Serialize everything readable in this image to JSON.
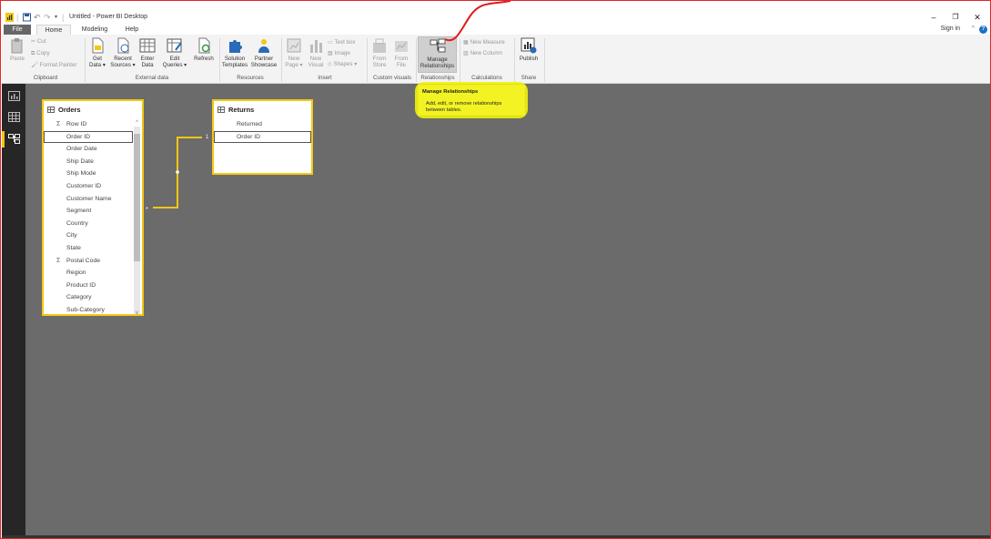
{
  "titlebar": {
    "app_title": "Untitled - Power BI Desktop",
    "minimize": "–",
    "restore": "❐",
    "close": "✕"
  },
  "tabs": {
    "file": "File",
    "home": "Home",
    "modeling": "Modeling",
    "help": "Help",
    "sign_in": "Sign in"
  },
  "ribbon": {
    "clipboard": {
      "paste": "Paste",
      "cut": "Cut",
      "copy": "Copy",
      "format_painter": "Format Painter",
      "group": "Clipboard"
    },
    "external_data": {
      "get_data": [
        "Get",
        "Data ▾"
      ],
      "recent_sources": [
        "Recent",
        "Sources ▾"
      ],
      "enter_data": [
        "Enter",
        "Data"
      ],
      "edit_queries": [
        "Edit",
        "Queries ▾"
      ],
      "refresh": "Refresh",
      "group": "External data"
    },
    "resources": {
      "solution_templates": [
        "Solution",
        "Templates"
      ],
      "partner_showcase": [
        "Partner",
        "Showcase"
      ],
      "group": "Resources"
    },
    "insert": {
      "new_page": [
        "New",
        "Page ▾"
      ],
      "new_visual": [
        "New",
        "Visual"
      ],
      "text_box": "Text box",
      "image": "Image",
      "shapes": "Shapes ▾",
      "group": "Insert"
    },
    "custom_visuals": {
      "from_store": [
        "From",
        "Store"
      ],
      "from_file": [
        "From",
        "File"
      ],
      "group": "Custom visuals"
    },
    "relationships": {
      "manage": [
        "Manage",
        "Relationships"
      ],
      "group": "Relationships"
    },
    "calculations": {
      "new_measure": "New Measure",
      "new_column": "New Column",
      "group": "Calculations"
    },
    "share": {
      "publish": "Publish",
      "group": "Share"
    }
  },
  "tooltip": {
    "title": "Manage Relationships",
    "text": "Add, edit, or remove relationships between tables."
  },
  "orders_table": {
    "title": "Orders",
    "fields": [
      "Row ID",
      "Order ID",
      "Order Date",
      "Ship Date",
      "Ship Mode",
      "Customer ID",
      "Customer Name",
      "Segment",
      "Country",
      "City",
      "State",
      "Postal Code",
      "Region",
      "Product ID",
      "Category",
      "Sub-Category"
    ]
  },
  "returns_table": {
    "title": "Returns",
    "fields": [
      "Returned",
      "Order ID"
    ]
  },
  "relationship": {
    "many": "*",
    "one": "1"
  },
  "colors": {
    "accent": "#f2c811",
    "canvas": "#6b6b6b",
    "nav": "#262626",
    "frame": "#e0262b"
  }
}
